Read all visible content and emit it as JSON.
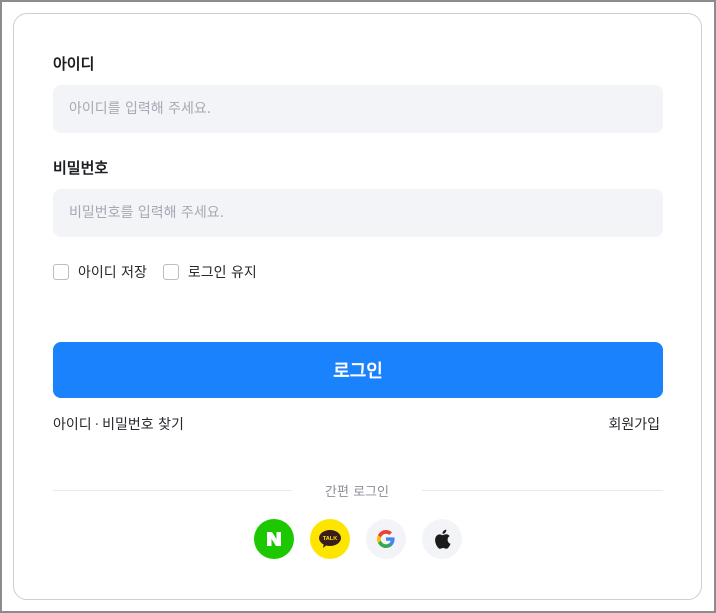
{
  "form": {
    "id_label": "아이디",
    "id_placeholder": "아이디를 입력해 주세요.",
    "pw_label": "비밀번호",
    "pw_placeholder": "비밀번호를 입력해 주세요.",
    "remember_id": "아이디 저장",
    "keep_login": "로그인 유지",
    "login_button": "로그인"
  },
  "links": {
    "find_id": "아이디",
    "separator": "·",
    "find_pw": "비밀번호 찾기",
    "signup": "회원가입"
  },
  "social": {
    "title": "간편 로그인",
    "providers": [
      {
        "name": "naver",
        "color": "#1ec800",
        "icon": "naver-n-icon"
      },
      {
        "name": "kakao",
        "color": "#fee500",
        "icon": "kakao-talk-icon",
        "text": "TALK"
      },
      {
        "name": "google",
        "color": "#f3f4f8",
        "icon": "google-g-icon"
      },
      {
        "name": "apple",
        "color": "#f3f4f8",
        "icon": "apple-icon"
      }
    ]
  },
  "colors": {
    "accent": "#1a82fc",
    "field_bg": "#f3f4f8"
  }
}
